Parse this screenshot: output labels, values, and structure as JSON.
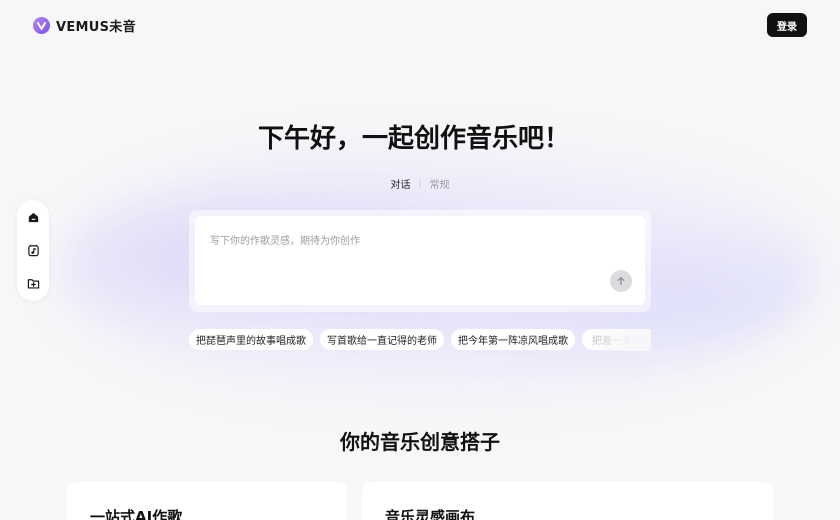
{
  "header": {
    "logo_text": "VEMUS未音",
    "login_label": "登录"
  },
  "hero": {
    "headline": "下午好，一起创作音乐吧！"
  },
  "mode_tabs": [
    {
      "label": "对话",
      "active": true
    },
    {
      "label": "常规",
      "active": false
    }
  ],
  "sidebar": {
    "items": [
      {
        "icon": "home-icon"
      },
      {
        "icon": "music-note-icon"
      },
      {
        "icon": "folder-add-icon"
      }
    ]
  },
  "composer": {
    "placeholder": "写下你的作歌灵感，期待为你创作",
    "value": "",
    "send_icon": "arrow-up-icon"
  },
  "suggestions": [
    {
      "label": "把琵琶声里的故事唱成歌"
    },
    {
      "label": "写首歌给一直记得的老师"
    },
    {
      "label": "把今年第一阵凉风唱成歌"
    },
    {
      "label": "把差一点没说"
    }
  ],
  "section": {
    "title": "你的音乐创意搭子"
  },
  "features": [
    {
      "title": "一站式AI作歌"
    },
    {
      "title": "音乐灵感画布"
    }
  ],
  "colors": {
    "accent": "#7b4fe0",
    "primary_button": "#111111",
    "background": "#f7f7f9",
    "glow": "#c8bef5"
  }
}
